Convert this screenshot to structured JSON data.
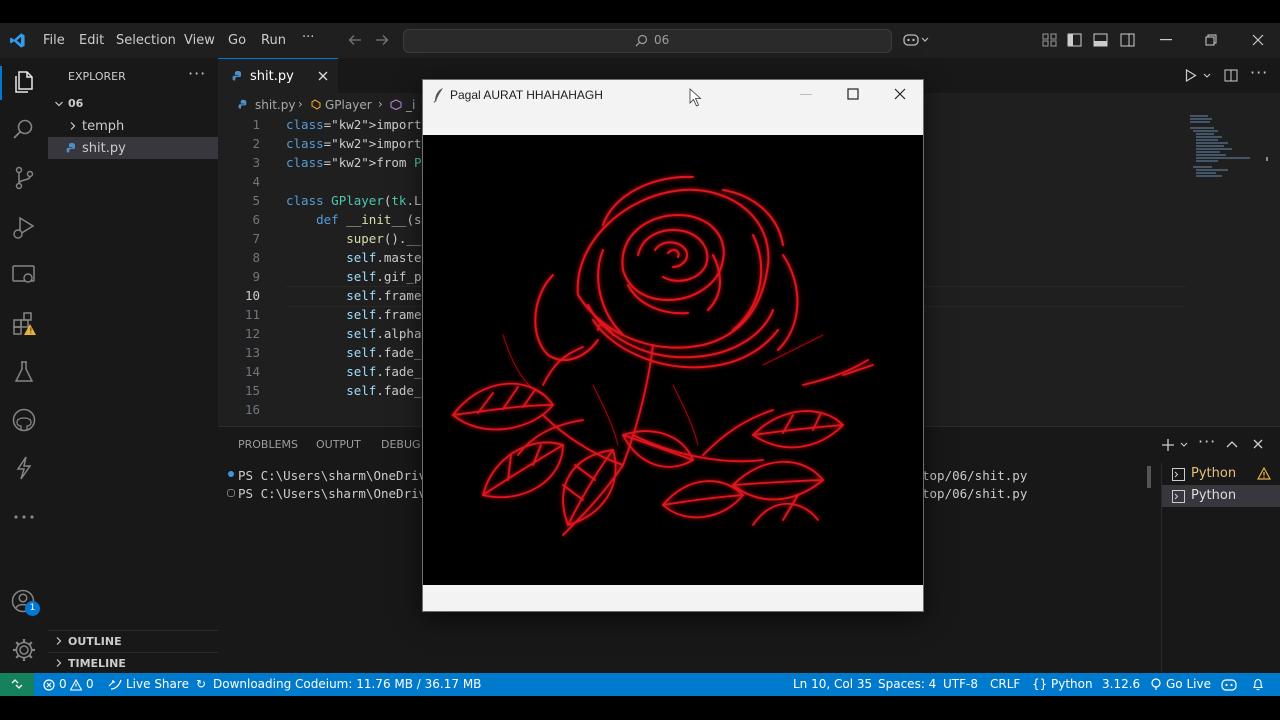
{
  "menu": [
    "File",
    "Edit",
    "Selection",
    "View",
    "Go",
    "Run",
    "···"
  ],
  "command_center": {
    "text": "06"
  },
  "explorer": {
    "header": "EXPLORER",
    "root": "06",
    "items": [
      "temph",
      "shit.py"
    ],
    "outline": "OUTLINE",
    "timeline": "TIMELINE"
  },
  "editor": {
    "tab_name": "shit.py",
    "breadcrumb": {
      "file": "shit.py",
      "class": "GPlayer",
      "tail": "_i"
    },
    "lines": [
      {
        "n": "1",
        "text": "import random"
      },
      {
        "n": "2",
        "text": "import tkinter as"
      },
      {
        "n": "3",
        "text": "from PIL import Im"
      },
      {
        "n": "4",
        "text": ""
      },
      {
        "n": "5",
        "text": "class GPlayer(tk.L"
      },
      {
        "n": "6",
        "text": "    def __init__(s"
      },
      {
        "n": "7",
        "text": "        super().__"
      },
      {
        "n": "8",
        "text": "        self.maste"
      },
      {
        "n": "9",
        "text": "        self.gif_p"
      },
      {
        "n": "10",
        "text": "        self.frame"
      },
      {
        "n": "11",
        "text": "        self.frame"
      },
      {
        "n": "12",
        "text": "        self.alpha"
      },
      {
        "n": "13",
        "text": "        self.fade_"
      },
      {
        "n": "14",
        "text": "        self.fade_"
      },
      {
        "n": "15",
        "text": "        self.fade_"
      },
      {
        "n": "16",
        "text": ""
      }
    ]
  },
  "panel": {
    "tabs": [
      "PROBLEMS",
      "OUTPUT",
      "DEBUG C"
    ],
    "terminal_lines": [
      {
        "left": "PS C:\\Users\\sharm\\OneDriv",
        "right": "top/06/shit.py"
      },
      {
        "left": "PS C:\\Users\\sharm\\OneDriv",
        "right": "top/06/shit.py"
      }
    ],
    "terminals": [
      "Python",
      "Python"
    ]
  },
  "tk_window": {
    "title": "Pagal AURAT HHAHAHAGH"
  },
  "statusbar": {
    "errors": "0",
    "warnings": "0",
    "live_share": "Live Share",
    "download": "Downloading Codeium: 11.76 MB / 36.17 MB",
    "position": "Ln 10, Col 35",
    "spaces": "Spaces: 4",
    "encoding": "UTF-8",
    "eol": "CRLF",
    "language": "Python",
    "version": "3.12.6",
    "go_live": "Go Live"
  },
  "accounts_badge": "1",
  "colors": {
    "accent": "#0078d4",
    "statusbar": "#007acc",
    "rose": "#e0141e"
  }
}
